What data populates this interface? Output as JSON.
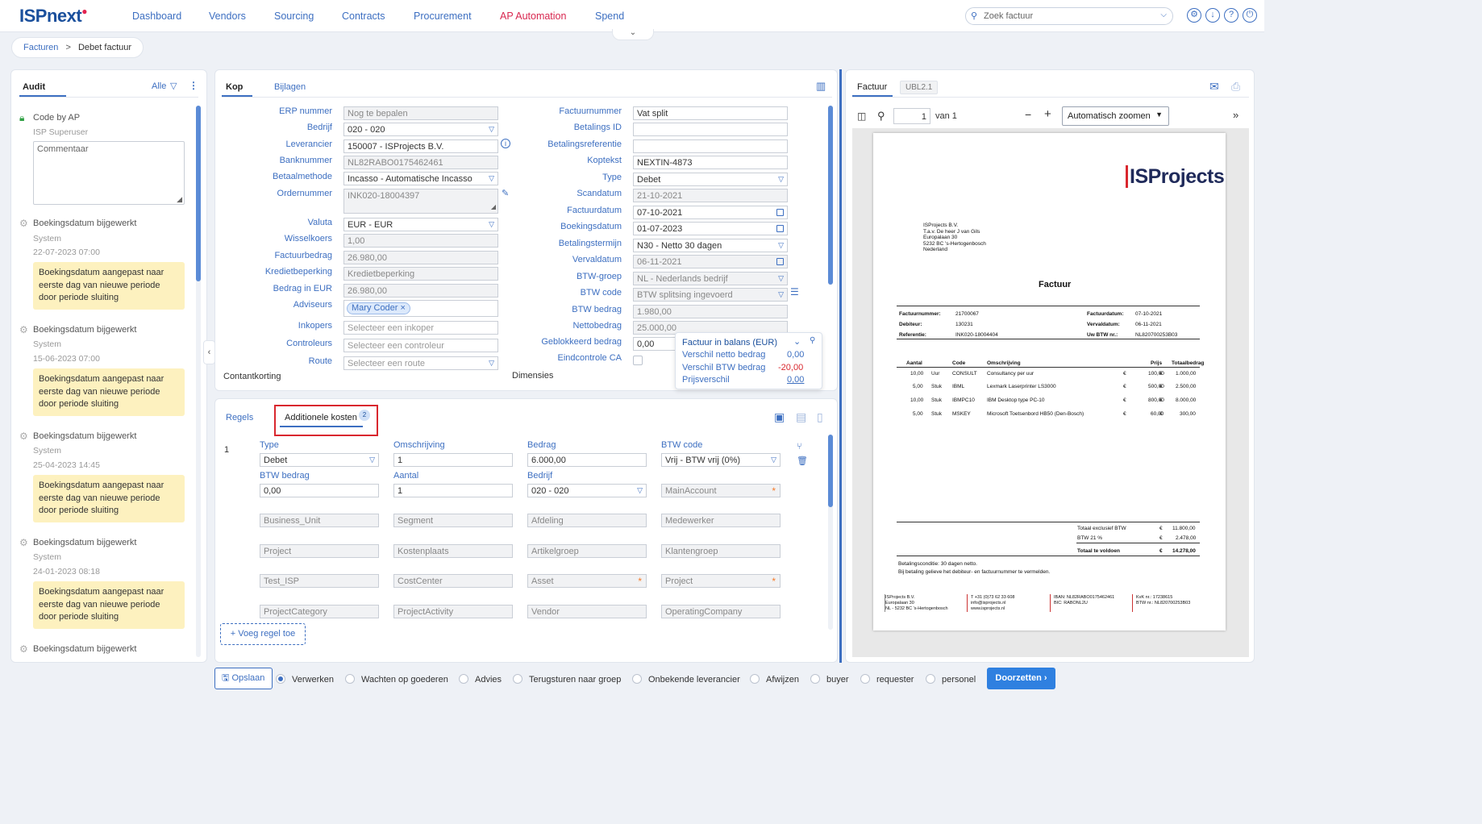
{
  "app": {
    "logo": "ISPnext"
  },
  "nav": [
    "Dashboard",
    "Vendors",
    "Sourcing",
    "Contracts",
    "Procurement",
    "AP Automation",
    "Spend"
  ],
  "search": {
    "placeholder": "Zoek factuur"
  },
  "top_icons": [
    "gear-icon",
    "download-icon",
    "help-icon",
    "power-icon"
  ],
  "breadcrumb": {
    "parent": "Facturen",
    "separator": ">",
    "current": "Debet factuur"
  },
  "audit": {
    "tab": "Audit",
    "filter": "Alle",
    "first": {
      "title": "Code by AP",
      "user": "ISP Superuser",
      "comment_placeholder": "Commentaar"
    },
    "entries": [
      {
        "title": "Boekingsdatum bijgewerkt",
        "user": "System",
        "date": "22-07-2023 07:00",
        "note": "Boekingsdatum aangepast naar eerste dag van nieuwe periode door periode sluiting"
      },
      {
        "title": "Boekingsdatum bijgewerkt",
        "user": "System",
        "date": "15-06-2023 07:00",
        "note": "Boekingsdatum aangepast naar eerste dag van nieuwe periode door periode sluiting"
      },
      {
        "title": "Boekingsdatum bijgewerkt",
        "user": "System",
        "date": "25-04-2023 14:45",
        "note": "Boekingsdatum aangepast naar eerste dag van nieuwe periode door periode sluiting"
      },
      {
        "title": "Boekingsdatum bijgewerkt",
        "user": "System",
        "date": "24-01-2023 08:18",
        "note": "Boekingsdatum aangepast naar eerste dag van nieuwe periode door periode sluiting"
      },
      {
        "title": "Boekingsdatum bijgewerkt"
      }
    ]
  },
  "header_tabs": {
    "kop": "Kop",
    "bijlagen": "Bijlagen"
  },
  "left_form": [
    {
      "label": "ERP nummer",
      "value": "Nog te bepalen"
    },
    {
      "label": "Bedrijf",
      "value": "020 - 020"
    },
    {
      "label": "Leverancier",
      "value": "150007 - ISProjects B.V."
    },
    {
      "label": "Banknummer",
      "value": "NL82RABO0175462461"
    },
    {
      "label": "Betaalmethode",
      "value": "Incasso - Automatische Incasso"
    },
    {
      "label": "Ordernummer",
      "value": "INK020-18004397"
    },
    {
      "label": "Valuta",
      "value": "EUR - EUR"
    },
    {
      "label": "Wisselkoers",
      "value": "1,00"
    },
    {
      "label": "Factuurbedrag",
      "value": "26.980,00"
    },
    {
      "label": "Kredietbeperking",
      "value": "Kredietbeperking"
    },
    {
      "label": "Bedrag in EUR",
      "value": "26.980,00"
    },
    {
      "label": "Adviseurs",
      "value": "Mary Coder"
    },
    {
      "label": "Inkopers",
      "value": "Selecteer een inkoper"
    },
    {
      "label": "Controleurs",
      "value": "Selecteer een controleur"
    },
    {
      "label": "Route",
      "value": "Selecteer een route"
    }
  ],
  "right_form": [
    {
      "label": "Factuurnummer",
      "value": "Vat split"
    },
    {
      "label": "Betalings ID",
      "value": ""
    },
    {
      "label": "Betalingsreferentie",
      "value": ""
    },
    {
      "label": "Koptekst",
      "value": "NEXTIN-4873"
    },
    {
      "label": "Type",
      "value": "Debet"
    },
    {
      "label": "Scandatum",
      "value": "21-10-2021"
    },
    {
      "label": "Factuurdatum",
      "value": "07-10-2021"
    },
    {
      "label": "Boekingsdatum",
      "value": "01-07-2023"
    },
    {
      "label": "Betalingstermijn",
      "value": "N30 - Netto 30 dagen"
    },
    {
      "label": "Vervaldatum",
      "value": "06-11-2021"
    },
    {
      "label": "BTW-groep",
      "value": "NL - Nederlands bedrijf"
    },
    {
      "label": "BTW code",
      "value": "BTW splitsing ingevoerd"
    },
    {
      "label": "BTW bedrag",
      "value": "1.980,00"
    },
    {
      "label": "Nettobedrag",
      "value": "25.000,00"
    },
    {
      "label": "Geblokkeerd bedrag",
      "value": "0,00"
    },
    {
      "label": "Eindcontrole CA",
      "value": ""
    }
  ],
  "sections": {
    "contantkorting": "Contantkorting",
    "dimensies": "Dimensies"
  },
  "balance": {
    "title": "Factuur in balans (EUR)",
    "rows": [
      {
        "label": "Verschil netto bedrag",
        "value": "0,00"
      },
      {
        "label": "Verschil BTW bedrag",
        "value": "-20,00"
      },
      {
        "label": "Prijsverschil",
        "value": "0,00"
      }
    ]
  },
  "lines_tabs": {
    "regels": "Regels",
    "additionele": "Additionele kosten",
    "badge": "2"
  },
  "cost_line": {
    "number": "1",
    "labels": {
      "type": "Type",
      "omschrijving": "Omschrijving",
      "bedrag": "Bedrag",
      "btw_code": "BTW code",
      "btw_bedrag": "BTW bedrag",
      "aantal": "Aantal",
      "bedrijf": "Bedrijf"
    },
    "values": {
      "type": "Debet",
      "omschrijving": "1",
      "bedrag": "6.000,00",
      "btw_code": "Vrij - BTW vrij (0%)",
      "btw_bedrag": "0,00",
      "aantal": "1",
      "bedrijf": "020 - 020",
      "main_account": "MainAccount"
    },
    "dimensions": [
      "Business_Unit",
      "Segment",
      "Afdeling",
      "Medewerker",
      "Project",
      "Kostenplaats",
      "Artikelgroep",
      "Klantengroep",
      "Test_ISP",
      "CostCenter",
      "Asset",
      "Project",
      "ProjectCategory",
      "ProjectActivity",
      "Vendor",
      "OperatingCompany"
    ],
    "add_button": "+ Voeg regel toe"
  },
  "footer": {
    "save": "Opslaan",
    "options": [
      "Verwerken",
      "Wachten op goederen",
      "Advies",
      "Terugsturen naar groep",
      "Onbekende leverancier",
      "Afwijzen",
      "buyer",
      "requester",
      "personel"
    ],
    "forward": "Doorzetten"
  },
  "viewer": {
    "tab": "Factuur",
    "tab2": "UBL2.1",
    "page": "1",
    "page_of": "van 1",
    "zoom": "Automatisch zoomen"
  },
  "invoice": {
    "logo": "ISProjects",
    "address": [
      "ISProjects B.V.",
      "T.a.v. De heer J van Gils",
      "Europalaan 30",
      "5232 BC 's-Hertogenbosch",
      "Nederland"
    ],
    "title": "Factuur",
    "meta_left": [
      [
        "Factuurnummer:",
        "21700067"
      ],
      [
        "Debiteur:",
        "130231"
      ],
      [
        "Referentie:",
        "INK020-18004404"
      ]
    ],
    "meta_right": [
      [
        "Factuurdatum:",
        "07-10-2021"
      ],
      [
        "Vervaldatum:",
        "06-11-2021"
      ],
      [
        "Uw BTW nr.:",
        "NL820700253B03"
      ]
    ],
    "cols": [
      "Aantal",
      "Code",
      "Omschrijving",
      "Prijs",
      "Totaalbedrag"
    ],
    "rows": [
      [
        "10,00",
        "Uur",
        "CONSULT",
        "Consultancy per uur",
        "€",
        "100,00",
        "€",
        "1.000,00"
      ],
      [
        "5,00",
        "Stuk",
        "IBML",
        "Lexmark Laserprinter LS3000",
        "€",
        "500,00",
        "€",
        "2.500,00"
      ],
      [
        "10,00",
        "Stuk",
        "IBMPC10",
        "IBM Desktop type PC-10",
        "€",
        "800,00",
        "€",
        "8.000,00"
      ],
      [
        "5,00",
        "Stuk",
        "MSKEY",
        "Microsoft Toetsenbord HB50 (Den-Bosch)",
        "€",
        "60,00",
        "€",
        "300,00"
      ]
    ],
    "totals": [
      [
        "Totaal exclusief BTW",
        "€",
        "11.800,00"
      ],
      [
        "BTW 21 %",
        "€",
        "2.478,00"
      ],
      [
        "Totaal te voldoen",
        "€",
        "14.278,00"
      ]
    ],
    "conditions": [
      "Betalingsconditie: 30 dagen netto.",
      "Bij betaling gelieve het debiteur- en factuurnummer te vermelden."
    ],
    "footer_cols": [
      [
        "ISProjects B.V.",
        "Europalaan 30",
        "NL - 5232 BC 's-Hertogenbosch"
      ],
      [
        "T +31 (0)73 62 33 608",
        "info@isprojects.nl",
        "www.isprojects.nl"
      ],
      [
        "IBAN: NL82RABO0175462461",
        "BIC: RABONL2U"
      ],
      [
        "KvK nr.: 17238615",
        "BTW nr.: NL820700253B03"
      ]
    ]
  },
  "colors": {
    "accent": "#3d6fc1",
    "active_nav": "#d8274f",
    "note_bg": "#fdf1bf",
    "highlight_border": "#d9272e",
    "primary_button": "#2f80e0"
  }
}
